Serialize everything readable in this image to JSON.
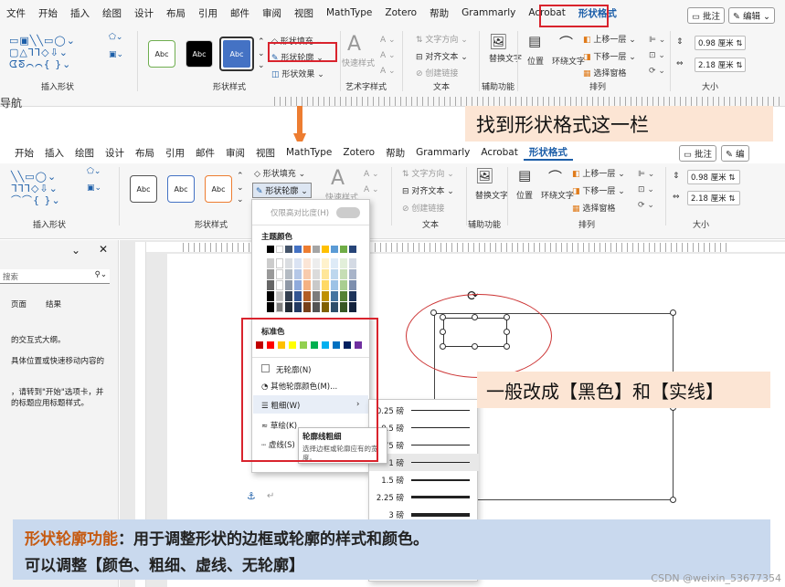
{
  "top_ribbon": {
    "tabs": [
      "文件",
      "开始",
      "插入",
      "绘图",
      "设计",
      "布局",
      "引用",
      "邮件",
      "审阅",
      "视图",
      "MathType",
      "Zotero",
      "帮助",
      "Grammarly",
      "Acrobat",
      "形状格式"
    ],
    "comment_btn": "批注",
    "edit_btn": "编辑",
    "gallery_text": "Abc",
    "fill_label": "形状填充",
    "outline_label": "形状轮廓",
    "effects_label": "形状效果",
    "quick_styles": "快速样式",
    "text_direction": "文字方向",
    "align_text": "对齐文本",
    "create_link": "创建链接",
    "alt_text": "替换文字",
    "position": "位置",
    "wrap_text": "环绕文字",
    "bring_forward": "上移一层",
    "send_backward": "下移一层",
    "selection_pane": "选择窗格",
    "height_value": "0.98 厘米",
    "width_value": "2.18 厘米",
    "groups": {
      "insert_shapes": "插入形状",
      "shape_styles": "形状样式",
      "wordart": "艺术字样式",
      "text": "文本",
      "accessibility": "辅助功能",
      "arrange": "排列",
      "size": "大小"
    },
    "nav_partial": "导航"
  },
  "callout_top": "找到形状格式这一栏",
  "second_ribbon": {
    "tabs": [
      "开始",
      "插入",
      "绘图",
      "设计",
      "布局",
      "引用",
      "邮件",
      "审阅",
      "视图",
      "MathType",
      "Zotero",
      "帮助",
      "Grammarly",
      "Acrobat",
      "形状格式"
    ],
    "comment_btn": "批注",
    "edit_btn_partial": "编"
  },
  "left_pane": {
    "search_placeholder": "搜索",
    "tab_pages": "页面",
    "tab_results": "结果",
    "text1": "的交互式大纲。",
    "text2": "具体位置或快速移动内容的",
    "text3": "，请转到\"开始\"选项卡，并",
    "text4": "的标题应用标题样式。"
  },
  "dropdown": {
    "high_contrast": "仅限高对比度(H)",
    "theme_colors": "主题颜色",
    "standard_colors": "标准色",
    "no_outline": "无轮廓(N)",
    "more_colors": "其他轮廓颜色(M)...",
    "weight": "粗细(W)",
    "sketch": "草绘(K)",
    "dashes": "虚线(S)",
    "theme_row": [
      "#000000",
      "#ffffff",
      "#44546a",
      "#4472c4",
      "#ed7d31",
      "#a5a5a5",
      "#ffc000",
      "#5b9bd5",
      "#70ad47",
      "#264478"
    ],
    "standard_row": [
      "#c00000",
      "#ff0000",
      "#ffc000",
      "#ffff00",
      "#92d050",
      "#00b050",
      "#00b0f0",
      "#0070c0",
      "#002060",
      "#7030a0"
    ]
  },
  "tooltip": {
    "title": "轮廓线粗细",
    "desc": "选择边框或轮廓应有的宽度。"
  },
  "weights": [
    {
      "label": "0.25 磅",
      "w": 0.25
    },
    {
      "label": "0.5 磅",
      "w": 0.5
    },
    {
      "label": "0.75 磅",
      "w": 0.75
    },
    {
      "label": "1 磅",
      "w": 1
    },
    {
      "label": "1.5 磅",
      "w": 1.5
    },
    {
      "label": "2.25 磅",
      "w": 2.25
    },
    {
      "label": "3 磅",
      "w": 3
    }
  ],
  "callout_mid": "一般改成【黑色】和【实线】",
  "bottom": {
    "highlight": "形状轮廓功能",
    "line1_rest": "：用于调整形状的边框或轮廓的样式和颜色。",
    "line2": "可以调整【颜色、粗细、虚线、无轮廓】"
  },
  "watermark": "CSDN @weixin_53677354",
  "colors": {
    "red_highlight": "#d9232d",
    "callout_bg": "#fce5d4",
    "bottom_bg": "#c9d9ee",
    "accent_orange": "#c55a11",
    "arrow": "#ed7d31",
    "tab_blue": "#1c5ea8"
  }
}
